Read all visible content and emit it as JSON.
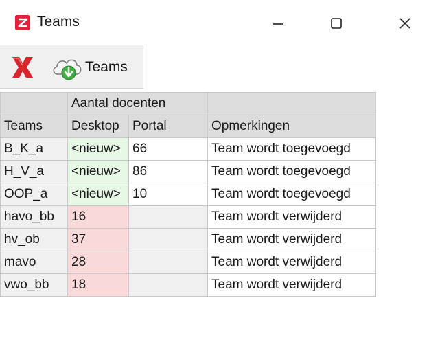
{
  "window": {
    "title": "Teams",
    "minimize_label": "—",
    "maximize_label": "☐",
    "close_label": "✕"
  },
  "toolbar": {
    "teams_label": "Teams"
  },
  "grid": {
    "group_header": "Aantal docenten",
    "columns": [
      "Teams",
      "Desktop",
      "Portal",
      "Opmerkingen"
    ],
    "rows": [
      {
        "team": "B_K_a",
        "desktop": "<nieuw>",
        "portal": "66",
        "remark": "Team wordt toegevoegd",
        "status": "new"
      },
      {
        "team": "H_V_a",
        "desktop": "<nieuw>",
        "portal": "86",
        "remark": "Team wordt toegevoegd",
        "status": "new"
      },
      {
        "team": "OOP_a",
        "desktop": "<nieuw>",
        "portal": "10",
        "remark": "Team wordt toegevoegd",
        "status": "new"
      },
      {
        "team": "havo_bb",
        "desktop": "16",
        "portal": "",
        "remark": "Team wordt verwijderd",
        "status": "delete"
      },
      {
        "team": "hv_ob",
        "desktop": "37",
        "portal": "",
        "remark": "Team wordt verwijderd",
        "status": "delete"
      },
      {
        "team": "mavo",
        "desktop": "28",
        "portal": "",
        "remark": "Team wordt verwijderd",
        "status": "delete"
      },
      {
        "team": "vwo_bb",
        "desktop": "18",
        "portal": "",
        "remark": "Team wordt verwijderd",
        "status": "delete"
      }
    ]
  },
  "colors": {
    "new_cell": "#e6f7e6",
    "delete_cell": "#f9d9d9",
    "header": "#dcdcdc",
    "app_icon": "#e0223a",
    "close_x": "#d9262c"
  },
  "icons": [
    "app-icon",
    "minimize-icon",
    "maximize-icon",
    "close-icon",
    "red-x-icon",
    "cloud-download-icon"
  ]
}
